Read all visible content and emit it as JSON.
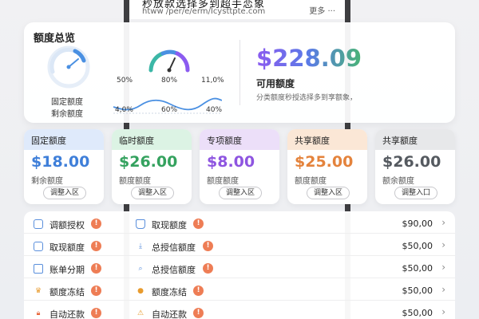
{
  "header": {
    "title": "秒放款选择多到超手恋象",
    "url": "htww /per/e/erm/Icysttpte.com",
    "more": "更多 ···"
  },
  "overview": {
    "title": "额度总览",
    "gauge_labels": [
      "固定额度",
      "剩余额度"
    ],
    "top_pcts": [
      "50%",
      "80%",
      "11,0%"
    ],
    "bottom_pcts": [
      "4,0%",
      "60%",
      "40%"
    ],
    "amount": "$228.09",
    "amount_label": "可用额度",
    "amount_desc": "分类额度秒授选择多到享额象，"
  },
  "cards": [
    {
      "title": "固定额度",
      "amount": "$18.00",
      "sub": "剩余额度",
      "button": "调整入区",
      "accent": "#3f7fd9",
      "head_bg": "#dfeafb"
    },
    {
      "title": "临时额度",
      "amount": "$26.00",
      "sub": "额度额度",
      "button": "调整入区",
      "accent": "#35a25f",
      "head_bg": "#dcf3e4"
    },
    {
      "title": "专项额度",
      "amount": "$8.00",
      "sub": "额度额度",
      "button": "调整入区",
      "accent": "#8e55e0",
      "head_bg": "#ecdff9"
    },
    {
      "title": "共享额度",
      "amount": "$25.00",
      "sub": "额度额度",
      "button": "调整入区",
      "accent": "#e4833c",
      "head_bg": "#fbe7d6"
    },
    {
      "title": "共享额度",
      "amount": "$26.00",
      "sub": "额余额度",
      "button": "调整入囗",
      "accent": "#555a60",
      "head_bg": "#e7e8ea"
    }
  ],
  "list": [
    {
      "left": "调额授权",
      "right": "取现额度",
      "value": "$90,00",
      "left_icon": "calendar-icon",
      "right_icon": "bag-icon"
    },
    {
      "left": "取现额度",
      "right": "总授信额度",
      "value": "$50,00",
      "left_icon": "calendar-icon",
      "right_icon": "download-icon"
    },
    {
      "left": "账单分期",
      "right": "总授信额度",
      "value": "$50,00",
      "left_icon": "folder-icon",
      "right_icon": "search-icon"
    },
    {
      "left": "额度冻结",
      "right": "额度冻结",
      "value": "$50,00",
      "left_icon": "crown-icon",
      "right_icon": "user-lock-icon"
    },
    {
      "left": "自动还款",
      "right": "自动还款",
      "value": "$50,00",
      "left_icon": "lock-icon",
      "right_icon": "warning-icon"
    }
  ],
  "colors": {
    "warning": "#ee7d55",
    "gauge_blue": "#4a90e2",
    "gauge_teal": "#3bb7a6",
    "gauge_purple": "#8b5bf0"
  }
}
